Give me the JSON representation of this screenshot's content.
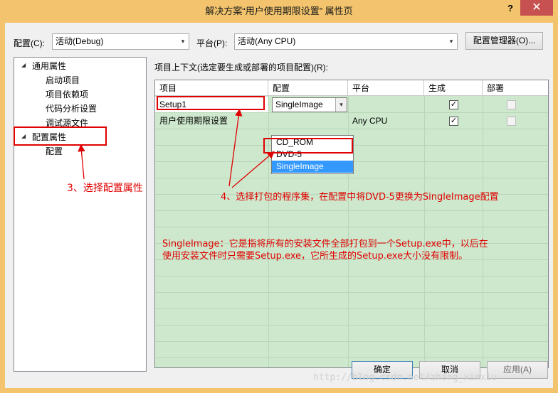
{
  "window": {
    "title": "解决方案“用户使用期限设置” 属性页",
    "help_label": "?",
    "close_label": "✕"
  },
  "config_row": {
    "config_label": "配置(C):",
    "config_value": "活动(Debug)",
    "platform_label": "平台(P):",
    "platform_value": "活动(Any CPU)",
    "manager_button": "配置管理器(O)..."
  },
  "tree": {
    "items": [
      {
        "label": "通用属性",
        "toggle": "◢"
      },
      {
        "label": "启动项目"
      },
      {
        "label": "项目依赖项"
      },
      {
        "label": "代码分析设置"
      },
      {
        "label": "调试源文件"
      },
      {
        "label": "配置属性",
        "toggle": "◢"
      },
      {
        "label": "配置"
      }
    ]
  },
  "grid": {
    "caption": "项目上下文(选定要生成或部署的项目配置)(R):",
    "headers": [
      "项目",
      "配置",
      "平台",
      "生成",
      "部署"
    ],
    "rows": [
      {
        "project": "Setup1",
        "config": "SingleImage",
        "platform": "",
        "build": true,
        "deploy": false
      },
      {
        "project": "用户使用期限设置",
        "config": "",
        "platform": "Any CPU",
        "build": true,
        "deploy": false
      }
    ],
    "dropdown_options": [
      "CD_ROM",
      "DVD-5",
      "SingleImage"
    ],
    "dropdown_arrow": "▾",
    "check_mark": "✓"
  },
  "buttons": {
    "ok": "确定",
    "cancel": "取消",
    "apply": "应用(A)"
  },
  "annotations": {
    "step3": "3、选择配置属性",
    "step4": "4、选择打包的程序集，在配置中将DVD-5更换为SingleImage配置",
    "note_line1": "SingleImage：它是指将所有的安装文件全部打包到一个Setup.exe中，以后在",
    "note_line2": "使用安装文件时只需要Setup.exe，它所生成的Setup.exe大小没有限制。"
  },
  "watermark": "http://blog.csdn.net/zhang_xinxiu",
  "colors": {
    "titlebar": "#f3c46d",
    "close": "#c75050",
    "grid_bg": "#cde8cd",
    "annotation": "#e00000",
    "selection": "#3399ff"
  }
}
